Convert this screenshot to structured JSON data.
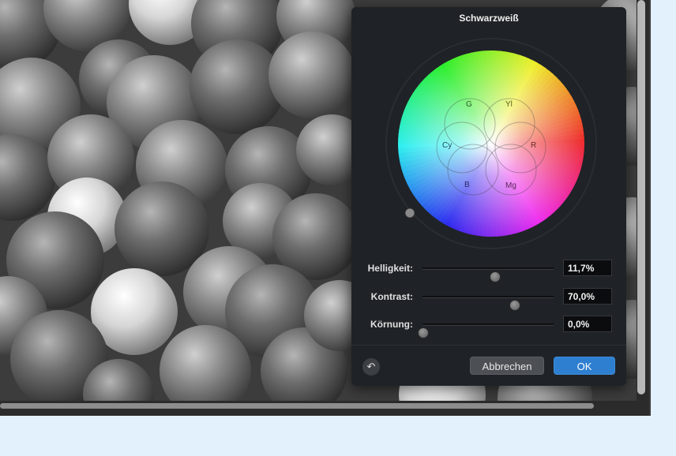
{
  "dialog": {
    "title": "Schwarzweiß",
    "wheel": {
      "labels": {
        "green": "G",
        "yellow": "Yl",
        "cyan": "Cy",
        "red": "R",
        "blue": "B",
        "magenta": "Mg"
      }
    },
    "sliders": [
      {
        "label": "Helligkeit:",
        "value_text": "11,7%",
        "position_fraction": 0.55
      },
      {
        "label": "Kontrast:",
        "value_text": "70,0%",
        "position_fraction": 0.7
      },
      {
        "label": "Körnung:",
        "value_text": "0,0%",
        "position_fraction": 0.0
      }
    ],
    "buttons": {
      "cancel": "Abbrechen",
      "ok": "OK",
      "reset_icon": "undo-arrow-icon"
    }
  },
  "colors": {
    "accent": "#2f7fd0",
    "dialog_bg": "#1f2226",
    "page_bg": "#e2f1fb"
  }
}
